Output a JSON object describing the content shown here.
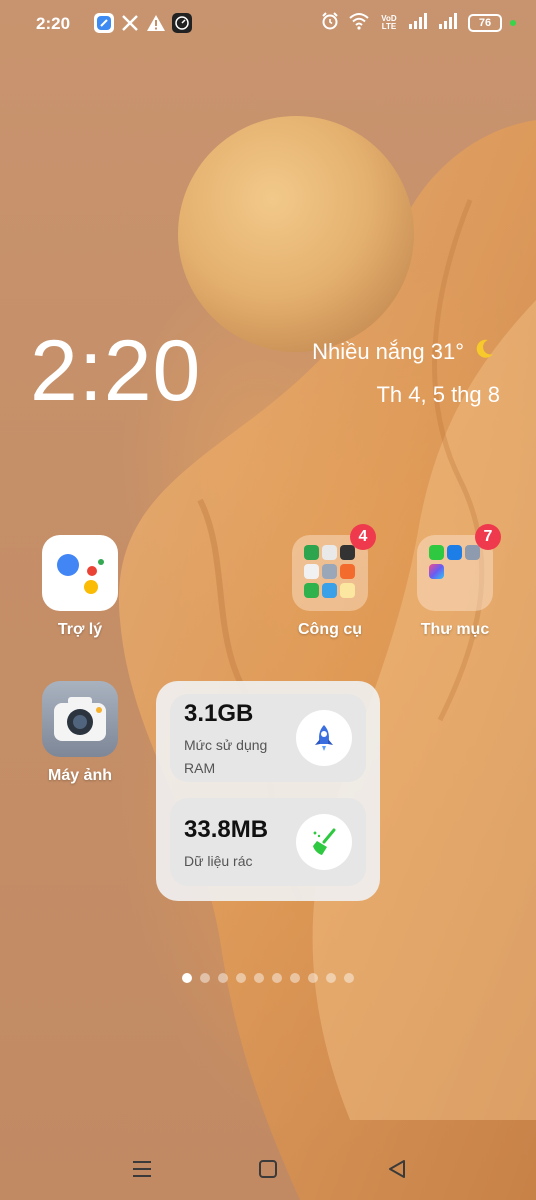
{
  "status_bar": {
    "time": "2:20",
    "battery": "76",
    "network_label": "VoD LTE",
    "notification_icons": [
      "note-app-icon",
      "x-icon",
      "warning-icon",
      "clock-app-icon"
    ],
    "status_icons": [
      "alarm-icon",
      "wifi-icon",
      "signal-icon",
      "signal-icon",
      "battery-icon"
    ]
  },
  "clock_widget": {
    "time": "2:20",
    "weather": "Nhiều nắng 31°",
    "weather_icon": "moon-icon",
    "date": "Th 4, 5 thg 8"
  },
  "apps": [
    {
      "label": "Trợ lý",
      "icon": "google-assistant-icon"
    },
    {
      "label": "Công cụ",
      "icon": "folder-icon",
      "badge": "4"
    },
    {
      "label": "Thư mục",
      "icon": "folder-icon",
      "badge": "7"
    },
    {
      "label": "Máy ảnh",
      "icon": "camera-icon"
    }
  ],
  "widget": {
    "ram_value": "3.1GB",
    "ram_label": "Mức sử dụng RAM",
    "ram_icon": "rocket-icon",
    "junk_value": "33.8MB",
    "junk_label": "Dữ liệu rác",
    "junk_icon": "broom-icon"
  },
  "pager": {
    "count": 10,
    "active": 0
  },
  "nav": {
    "icons": [
      "menu-icon",
      "home-icon",
      "back-icon"
    ]
  },
  "colors": {
    "badge": "#ef3a4d",
    "wallpaper": "#c58f68",
    "widget_bg": "#f0f0f0",
    "rocket": "#3b6fe0",
    "broom": "#2ec940"
  }
}
